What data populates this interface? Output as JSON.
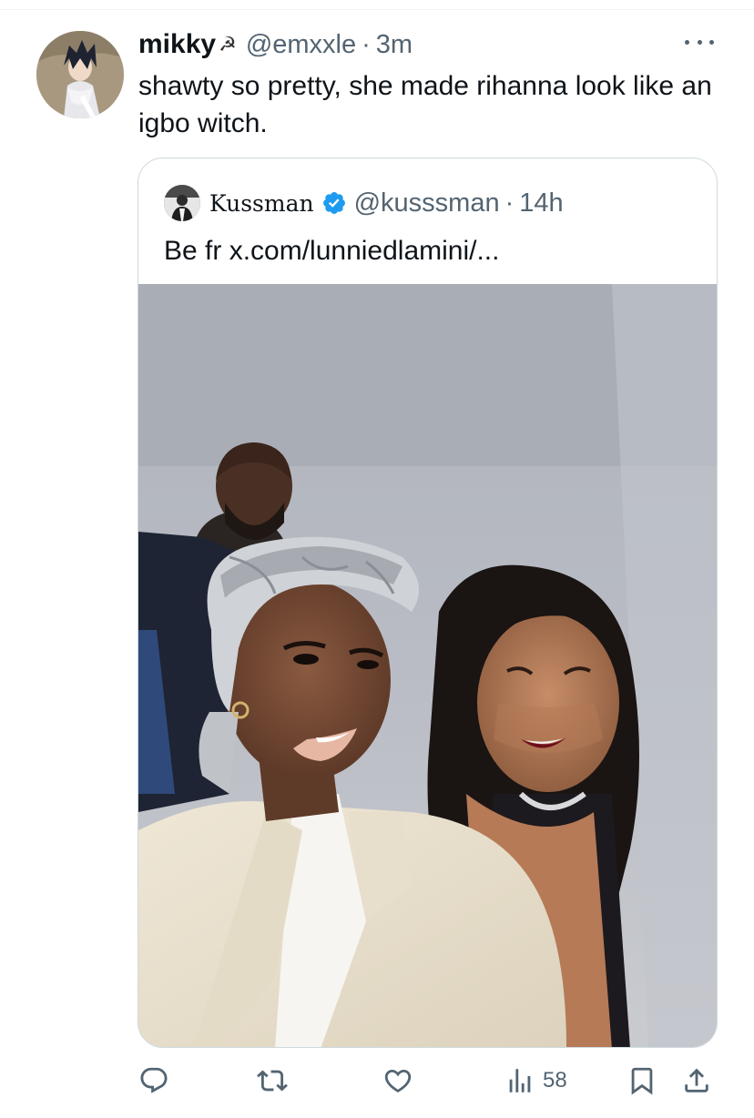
{
  "tweet": {
    "display_name": "mikky",
    "name_emoji": "☭",
    "handle": "@emxxle",
    "separator": "·",
    "time": "3m",
    "text": "shawty so pretty, she made rihanna look like an igbo witch."
  },
  "quote": {
    "display_name": "Kussman",
    "handle": "@kusssman",
    "separator": "·",
    "time": "14h",
    "text": "Be fr x.com/lunniedlamini/..."
  },
  "actions": {
    "views_count": "58"
  },
  "colors": {
    "text_primary": "#0f1419",
    "text_secondary": "#536471",
    "border": "#cfd9de",
    "verified_blue": "#1d9bf0"
  },
  "icons": [
    "more-icon",
    "verified-badge-icon",
    "reply-icon",
    "retweet-icon",
    "like-icon",
    "views-icon",
    "bookmark-icon",
    "share-icon"
  ]
}
